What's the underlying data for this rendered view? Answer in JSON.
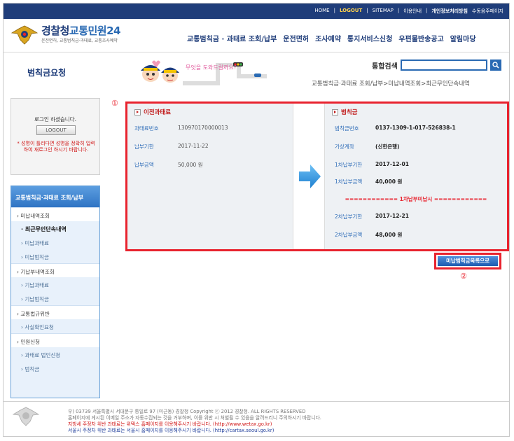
{
  "top_links": [
    "HOME",
    "LOGOUT",
    "SITEMAP",
    "이용안내",
    "개인정보처리방침",
    "수동음주페이지"
  ],
  "logo": {
    "title_part1": "경찰청",
    "title_part2": "교통민원24",
    "subtitle": "운전면허, 교통범칙금·과태료, 교통조사예약"
  },
  "gnb": [
    "교통범칙금 · 과태료 조회/납부",
    "운전면허",
    "조사예약",
    "통지서비스신청",
    "우편물반송공고",
    "알림마당"
  ],
  "page_title": "범칙금요청",
  "mascot_bubble": "무엇을 도와드릴까요?",
  "search": {
    "label": "통합검색",
    "value": ""
  },
  "breadcrumb": "교통범칙금·과태료 조회/납부>미납내역조회>최근무인단속내역",
  "login": {
    "message": "로그인 하셨습니다.",
    "logout_label": "LOGOUT",
    "warning": "* 성명이 틀리다면 성명을 정확히 입력하여 재로그인 하시기 바랍니다."
  },
  "lnb": {
    "title": "교통범칙금·과태료 조회/납부",
    "items": [
      {
        "label": "미납내역조회",
        "type": "main"
      },
      {
        "label": "최근무인단속내역",
        "type": "active"
      },
      {
        "label": "미납과태료",
        "type": "sub"
      },
      {
        "label": "미납범칙금",
        "type": "sub"
      },
      {
        "label": "기납부내역조회",
        "type": "main"
      },
      {
        "label": "기납과태료",
        "type": "sub"
      },
      {
        "label": "기납범칙금",
        "type": "sub"
      },
      {
        "label": "교통법규위반",
        "type": "main"
      },
      {
        "label": "사실확인요청",
        "type": "sub"
      },
      {
        "label": "민원신청",
        "type": "main"
      },
      {
        "label": "과태료 법인신청",
        "type": "sub"
      },
      {
        "label": "범칙금",
        "type": "sub"
      }
    ]
  },
  "markers": {
    "one": "①",
    "two": "②"
  },
  "left_panel": {
    "title": "이전과태료",
    "rows": [
      {
        "key": "과태료번호",
        "value": "130970170000013"
      },
      {
        "key": "납부기한",
        "value": "2017-11-22"
      },
      {
        "key": "납부금액",
        "value": "50,000 원"
      }
    ]
  },
  "right_panel": {
    "title": "범칙금",
    "rows": [
      {
        "key": "범칙금번호",
        "value": "0137-1309-1-017-526838-1"
      },
      {
        "key": "가상계좌",
        "value": "(신한은행)"
      },
      {
        "key": "1차납부기한",
        "value": "2017-12-01"
      },
      {
        "key": "1차납부금액",
        "value": "40,000 원"
      }
    ],
    "separator": "============ 1차납부미납시 ============",
    "rows2": [
      {
        "key": "2차납부기한",
        "value": "2017-12-21"
      },
      {
        "key": "2차납부금액",
        "value": "48,000 원"
      }
    ]
  },
  "list_button": "미납범칙금목록으로",
  "footer": {
    "line1": "우) 03739 서울특별시 서대문구 통일로 97 (미근동) 경찰청   Copyright ⓒ 2012 경찰청. ALL RIGHTS RESERVED",
    "line2": "홈페이지에 게시된 이메일 주소가 자동수집되는 것을 거부하며, 이를 위반 시 처벌될 수 있음을 알려드리니 주의하시기 바랍니다.",
    "line3": "지방세 주정차 위반 과태료는 위택스 홈페이지를 이용해주시기 바랍니다. (http://www.wetax.go.kr)",
    "line4": "서울시 주정차 위반 과태료는 서울시 홈페이지를 이용해주시기 바랍니다. (http://cartax.seoul.go.kr)"
  },
  "colors": {
    "navy": "#1f3d7a",
    "blue": "#2a6ab3",
    "red": "#e8232e"
  }
}
